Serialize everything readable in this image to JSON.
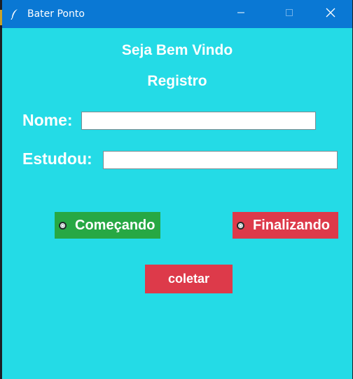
{
  "window": {
    "title": "Bater Ponto",
    "titlebar_color": "#0a78d4",
    "background_color": "#24dbe6"
  },
  "titlebar": {
    "app_icon": "feather-icon",
    "minimize_icon": "minimize-icon",
    "maximize_icon": "maximize-icon",
    "close_icon": "close-icon"
  },
  "main": {
    "welcome": "Seja Bem Vindo",
    "subtitle": "Registro",
    "nome_label": "Nome:",
    "nome_value": "",
    "estudou_label": "Estudou:",
    "estudou_value": "",
    "radio_start_label": "Começando",
    "radio_start_color": "#27a844",
    "radio_end_label": "Finalizando",
    "radio_end_color": "#dd3a4a",
    "collect_button_label": "coletar",
    "collect_button_color": "#dd3a4a"
  }
}
